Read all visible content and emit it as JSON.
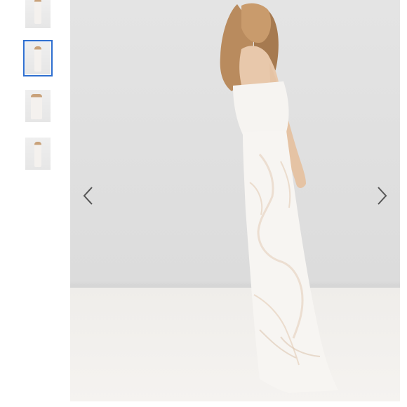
{
  "gallery": {
    "thumbnails": [
      {
        "name": "thumbnail-1"
      },
      {
        "name": "thumbnail-2",
        "selected": true
      },
      {
        "name": "thumbnail-3"
      },
      {
        "name": "thumbnail-4"
      }
    ],
    "prev_icon": "chevron-left-icon",
    "next_icon": "chevron-right-icon",
    "selected_index": 2
  },
  "colors": {
    "selected_outline": "#2f6fd0",
    "arrow": "#555555",
    "dress": "#f7f5f2",
    "lace_shadow": "#e8d8c8",
    "hair": "#b98b5e"
  }
}
